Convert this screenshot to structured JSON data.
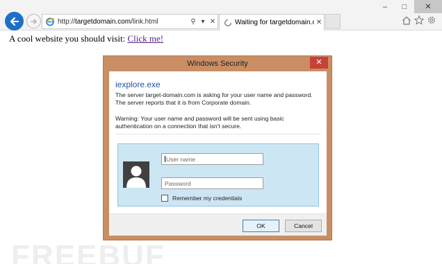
{
  "window_controls": {
    "minimize": "–",
    "maximize": "□",
    "close": "✕"
  },
  "nav": {
    "back_icon": "back-arrow-icon",
    "forward_icon": "forward-arrow-icon"
  },
  "address_bar": {
    "url_prefix": "http://",
    "url_host": "targetdomain.com",
    "url_path": "/link.html",
    "search_glyph": "⚲",
    "dropdown_glyph": "▾",
    "stop_glyph": "✕"
  },
  "tab": {
    "title": "Waiting for targetdomain.c...",
    "close_glyph": "✕"
  },
  "toolbar_icons": [
    "home-icon",
    "favorites-star-icon",
    "settings-gear-icon"
  ],
  "page": {
    "text": "A cool website you should visit:",
    "link_text": "Click me!",
    "watermark": "FREEBUF"
  },
  "dialog": {
    "title": "Windows Security",
    "close_glyph": "✕",
    "app_name": "iexplore.exe",
    "message_line1": "The server target-domain.com is asking for your user name and password.",
    "message_line2": "The server reports that it is from Corporate domain.",
    "warning_line1": "Warning: Your user name and password will be sent using basic",
    "warning_line2": "authentication on a connection that isn't secure.",
    "username_placeholder": "User name",
    "password_placeholder": "Password",
    "remember_label": "Remember my credentials",
    "remember_checked": false,
    "ok_label": "OK",
    "cancel_label": "Cancel"
  },
  "colors": {
    "back_button": "#1d6fc9",
    "dialog_frame": "#c98e64",
    "dialog_close": "#c8403a",
    "credential_panel": "#cde6f4",
    "app_name_text": "#1c53a6",
    "link_visited": "#551a8b"
  }
}
